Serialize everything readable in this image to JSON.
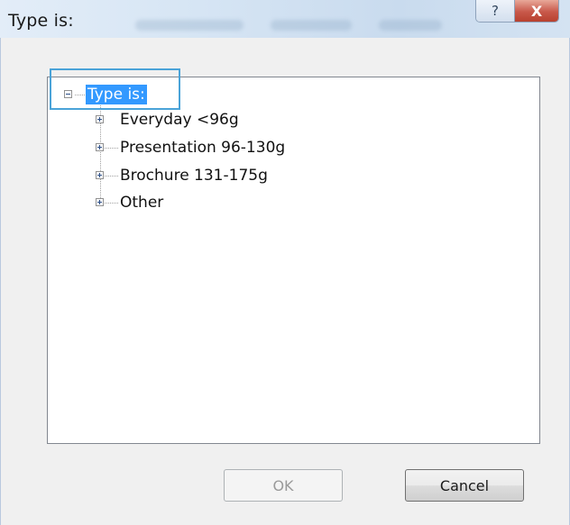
{
  "window": {
    "title": "Type is:",
    "help_glyph": "?",
    "close_glyph": "X"
  },
  "tree": {
    "root": {
      "label": "Type is:",
      "expanded": true,
      "selected": true
    },
    "children": [
      {
        "label": "Everyday <96g",
        "expanded": false
      },
      {
        "label": "Presentation 96-130g",
        "expanded": false
      },
      {
        "label": "Brochure 131-175g",
        "expanded": false
      },
      {
        "label": "Other",
        "expanded": false
      }
    ]
  },
  "buttons": {
    "ok_label": "OK",
    "ok_enabled": false,
    "cancel_label": "Cancel"
  },
  "colors": {
    "selection": "#3399ff",
    "callout": "#4aa3d8",
    "close_button": "#c8584a"
  },
  "icons": [
    "help-icon",
    "close-icon",
    "collapse-icon",
    "expand-icon"
  ]
}
